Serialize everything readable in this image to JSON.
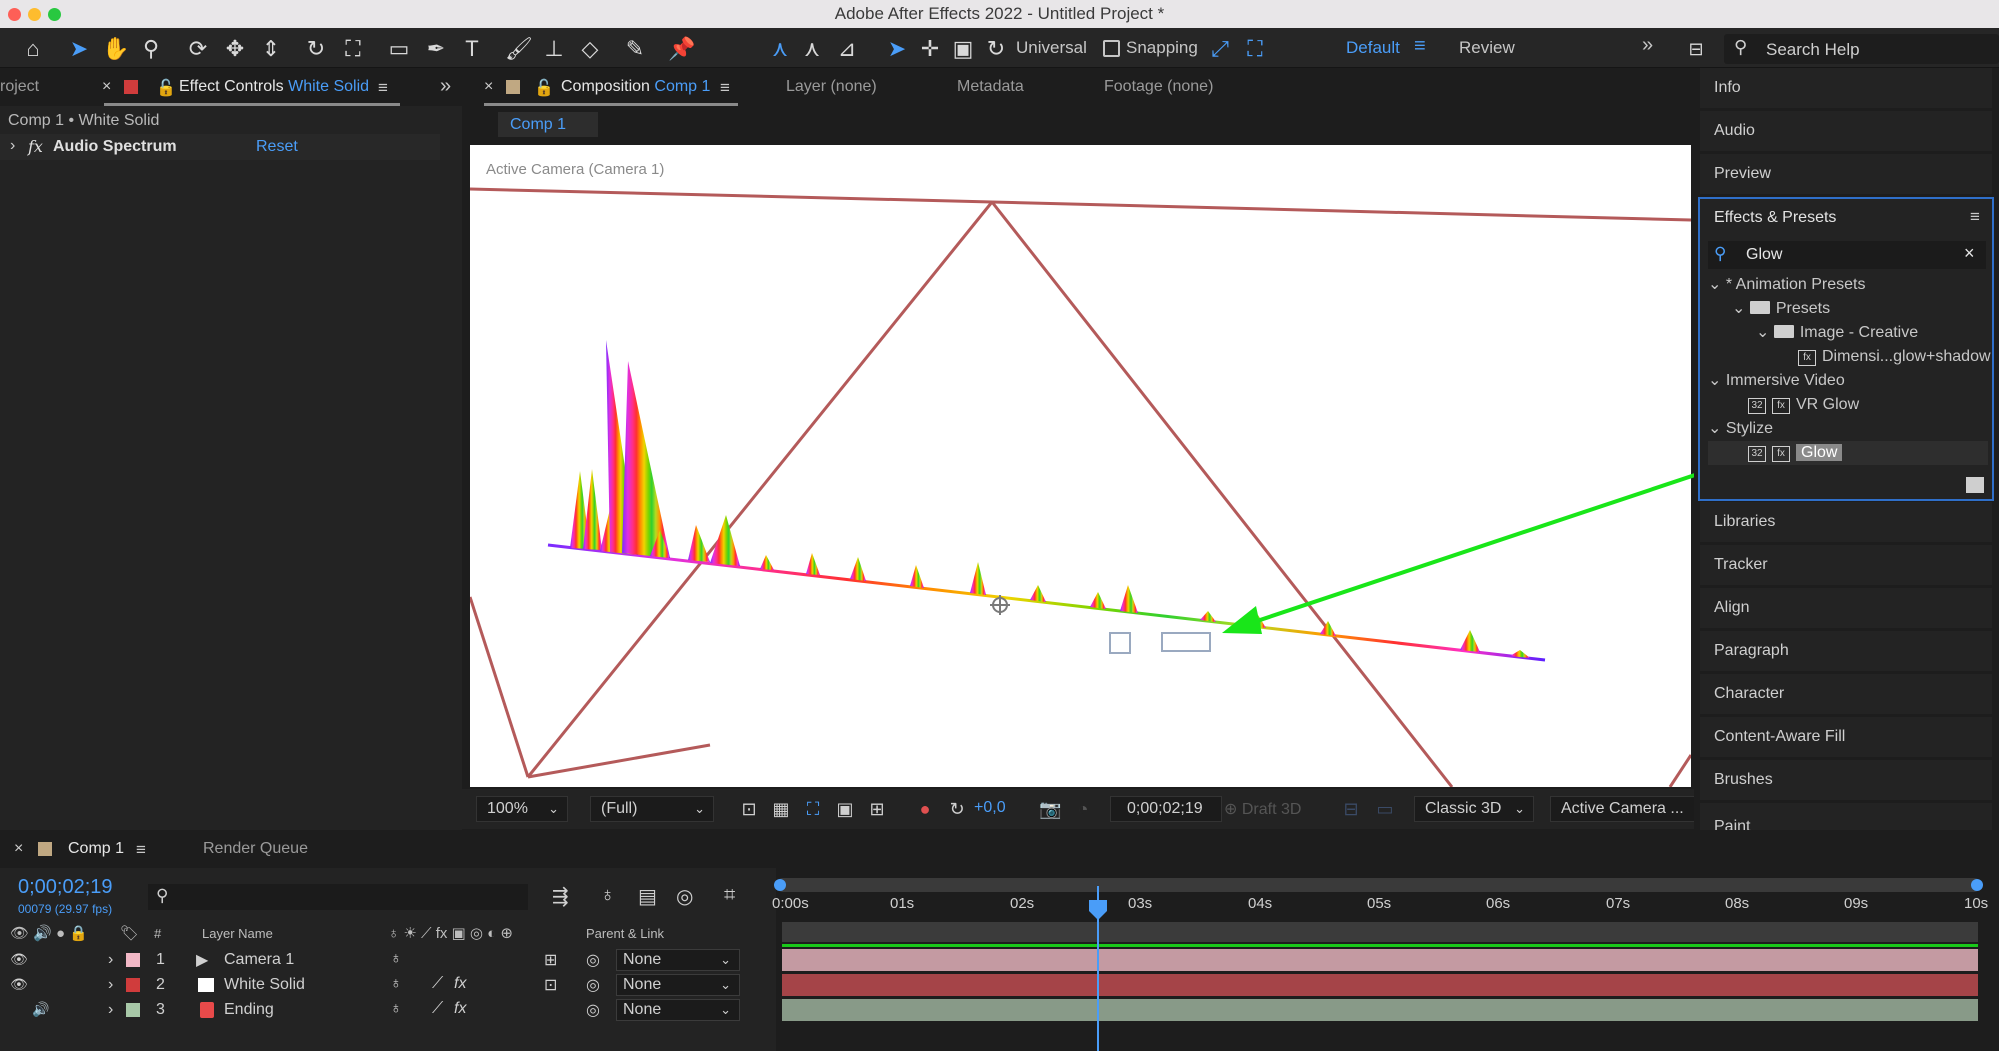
{
  "app": {
    "title": "Adobe After Effects 2022 - Untitled Project *"
  },
  "toolbar": {
    "axis_mode": "Universal",
    "snapping": "Snapping",
    "workspace_default": "Default",
    "workspace_review": "Review",
    "search_help": "Search Help"
  },
  "left_panel": {
    "project_tab": "roject",
    "effect_controls_prefix": "Effect Controls",
    "effect_controls_layer": "White Solid",
    "layer_path": "Comp 1 • White Solid",
    "fx_badge": "fx",
    "effect_name": "Audio Spectrum",
    "reset_label": "Reset"
  },
  "comp_panel": {
    "composition_prefix": "Composition",
    "composition_name": "Comp 1",
    "layer_tab": "Layer (none)",
    "metadata_tab": "Metadata",
    "footage_tab": "Footage (none)",
    "breadcrumb": "Comp 1",
    "camera_label": "Active Camera (Camera 1)"
  },
  "viewer_bar": {
    "zoom": "100%",
    "resolution": "(Full)",
    "exposure": "+0,0",
    "timecode": "0;00;02;19",
    "draft3d": "Draft 3D",
    "renderer": "Classic 3D",
    "view": "Active Camera ..."
  },
  "right_dock": {
    "items_top": [
      "Info",
      "Audio",
      "Preview"
    ],
    "effects_presets": {
      "title": "Effects & Presets",
      "search_value": "Glow",
      "tree": {
        "animation_presets": "* Animation Presets",
        "presets": "Presets",
        "image_creative": "Image - Creative",
        "dimensional": "Dimensi...glow+shadow",
        "immersive_video": "Immersive Video",
        "vr_glow": "VR Glow",
        "stylize": "Stylize",
        "glow": "Glow",
        "badge_32": "32"
      }
    },
    "items_bottom": [
      "Libraries",
      "Tracker",
      "Align",
      "Paragraph",
      "Character",
      "Content-Aware Fill",
      "Brushes",
      "Paint"
    ]
  },
  "timeline": {
    "comp_tab": "Comp 1",
    "render_queue": "Render Queue",
    "timecode": "0;00;02;19",
    "frame_info": "00079 (29.97 fps)",
    "col_hash": "#",
    "col_layer_name": "Layer Name",
    "col_parent": "Parent & Link",
    "ticks": [
      "0:00s",
      "01s",
      "02s",
      "03s",
      "04s",
      "05s",
      "06s",
      "07s",
      "08s",
      "09s",
      "10s"
    ],
    "layers": [
      {
        "num": "1",
        "name": "Camera 1",
        "label_color": "#f2b8c6",
        "parent": "None",
        "track_color": "#c49aa2"
      },
      {
        "num": "2",
        "name": "White Solid",
        "label_color": "#d03c3c",
        "parent": "None",
        "track_color": "#a54448"
      },
      {
        "num": "3",
        "name": "Ending",
        "label_color": "#a8c8a8",
        "parent": "None",
        "track_color": "#889a88"
      }
    ]
  },
  "colors": {
    "accent_blue": "#4a9df8",
    "arrow_green": "#19e619",
    "camera_frame": "#b45a5a"
  }
}
